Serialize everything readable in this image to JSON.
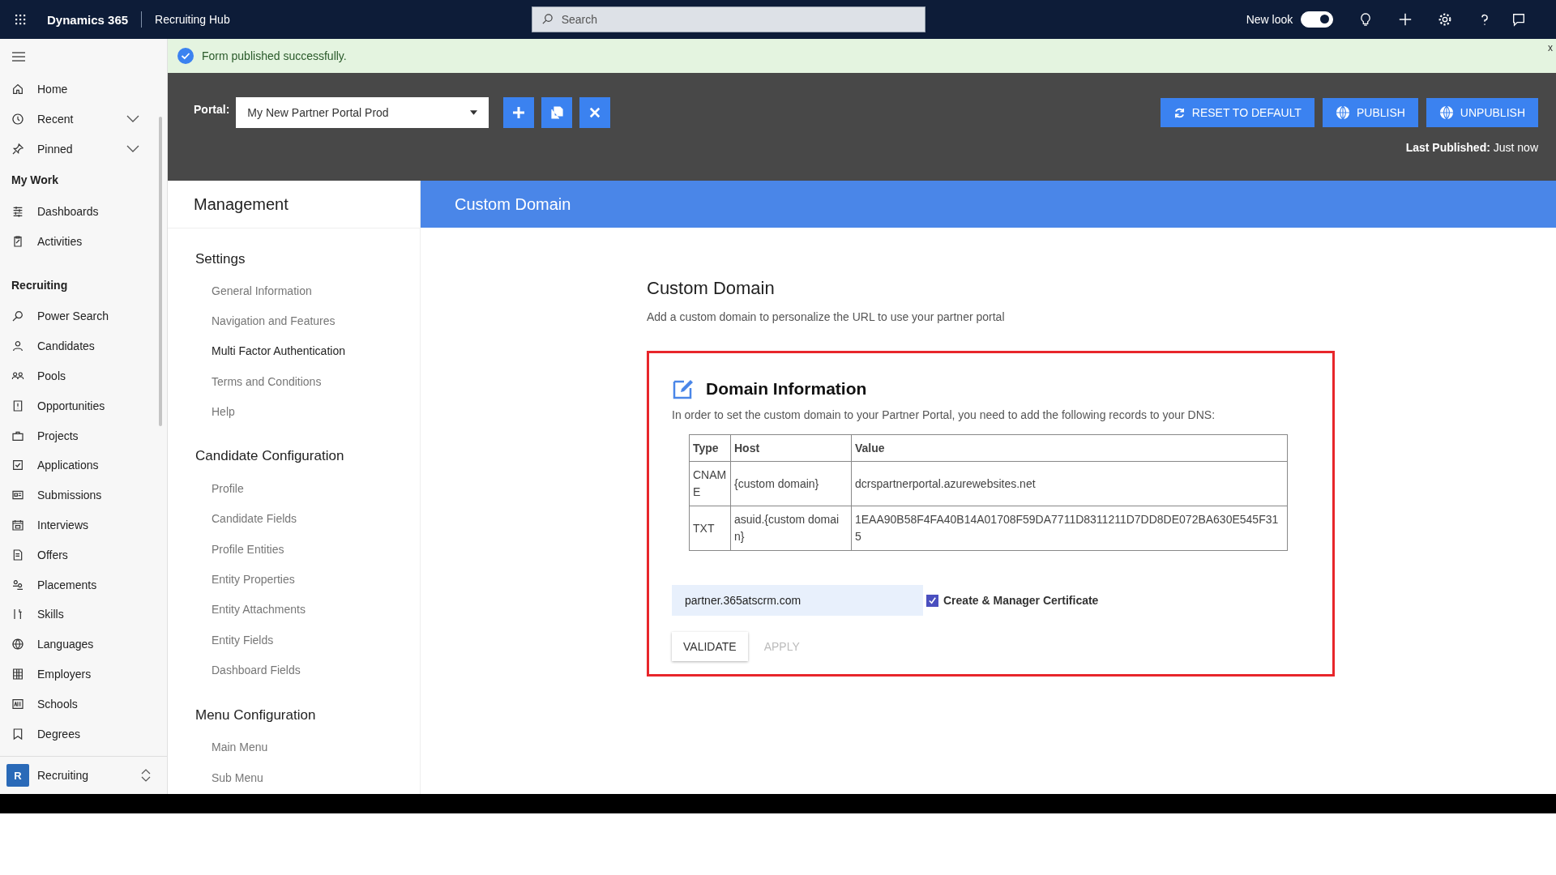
{
  "top_bar": {
    "app_name": "Dynamics 365",
    "area_name": "Recruiting Hub",
    "search": {
      "placeholder": "Search"
    },
    "new_look": {
      "label": "New look",
      "on": true
    }
  },
  "notification": {
    "text": "Form published successfully.",
    "dismiss": "x"
  },
  "nav": {
    "sections": [
      {
        "items": [
          {
            "label": "Home",
            "kind": "link"
          },
          {
            "label": "Recent",
            "kind": "expandable"
          },
          {
            "label": "Pinned",
            "kind": "expandable"
          }
        ]
      },
      {
        "heading": "My Work",
        "items": [
          {
            "label": "Dashboards",
            "kind": "link"
          },
          {
            "label": "Activities",
            "kind": "link"
          }
        ]
      },
      {
        "heading": "Recruiting",
        "items": [
          {
            "label": "Power Search",
            "kind": "link"
          },
          {
            "label": "Candidates",
            "kind": "link"
          },
          {
            "label": "Pools",
            "kind": "link"
          },
          {
            "label": "Opportunities",
            "kind": "link"
          },
          {
            "label": "Projects",
            "kind": "link"
          },
          {
            "label": "Applications",
            "kind": "link"
          },
          {
            "label": "Submissions",
            "kind": "link"
          },
          {
            "label": "Interviews",
            "kind": "link"
          },
          {
            "label": "Offers",
            "kind": "link"
          },
          {
            "label": "Placements",
            "kind": "link"
          },
          {
            "label": "Skills",
            "kind": "link"
          },
          {
            "label": "Languages",
            "kind": "link"
          },
          {
            "label": "Employers",
            "kind": "link"
          },
          {
            "label": "Schools",
            "kind": "link"
          },
          {
            "label": "Degrees",
            "kind": "link"
          }
        ]
      }
    ],
    "area_switcher": {
      "badge": "R",
      "label": "Recruiting"
    }
  },
  "portal": {
    "label": "Portal:",
    "selected": "My New Partner Portal Prod",
    "actions": [
      "RESET TO DEFAULT",
      "PUBLISH",
      "UNPUBLISH"
    ],
    "last_published": {
      "label": "Last Published:",
      "value": "Just now"
    }
  },
  "management": {
    "title": "Management",
    "sections": [
      {
        "heading": "Settings",
        "items": [
          {
            "label": "General Information",
            "selected": false
          },
          {
            "label": "Navigation and Features",
            "selected": false
          },
          {
            "label": "Multi Factor Authentication",
            "selected": true
          },
          {
            "label": "Terms and Conditions",
            "selected": false
          },
          {
            "label": "Help",
            "selected": false
          }
        ]
      },
      {
        "heading": "Candidate Configuration",
        "items": [
          {
            "label": "Profile",
            "selected": false
          },
          {
            "label": "Candidate Fields",
            "selected": false
          },
          {
            "label": "Profile Entities",
            "selected": false
          },
          {
            "label": "Entity Properties",
            "selected": false
          },
          {
            "label": "Entity Attachments",
            "selected": false
          },
          {
            "label": "Entity Fields",
            "selected": false
          },
          {
            "label": "Dashboard Fields",
            "selected": false
          }
        ]
      },
      {
        "heading": "Menu Configuration",
        "items": [
          {
            "label": "Main Menu",
            "selected": false
          },
          {
            "label": "Sub Menu",
            "selected": false
          }
        ]
      }
    ]
  },
  "page_header": "Custom Domain",
  "content": {
    "title": "Custom Domain",
    "subtitle": "Add a custom domain to personalize the URL to use your partner portal",
    "card": {
      "title": "Domain Information",
      "description": "In order to set the custom domain to your Partner Portal, you need to add the following records to your DNS:",
      "table": {
        "columns": [
          "Type",
          "Host",
          "Value"
        ],
        "rows": [
          [
            "CNAME",
            "{custom domain}",
            "dcrspartnerportal.azurewebsites.net"
          ],
          [
            "TXT",
            "asuid.{custom domain}",
            "1EAA90B58F4FA40B14A01708F59DA7711D8311211D7DD8DE072BA630E545F315"
          ]
        ]
      },
      "domain_input": {
        "value": "partner.365atscrm.com"
      },
      "certificate": {
        "label": "Create & Manager Certificate",
        "checked": true
      },
      "buttons": [
        {
          "label": "VALIDATE",
          "disabled": false
        },
        {
          "label": "APPLY",
          "disabled": true
        }
      ]
    }
  }
}
